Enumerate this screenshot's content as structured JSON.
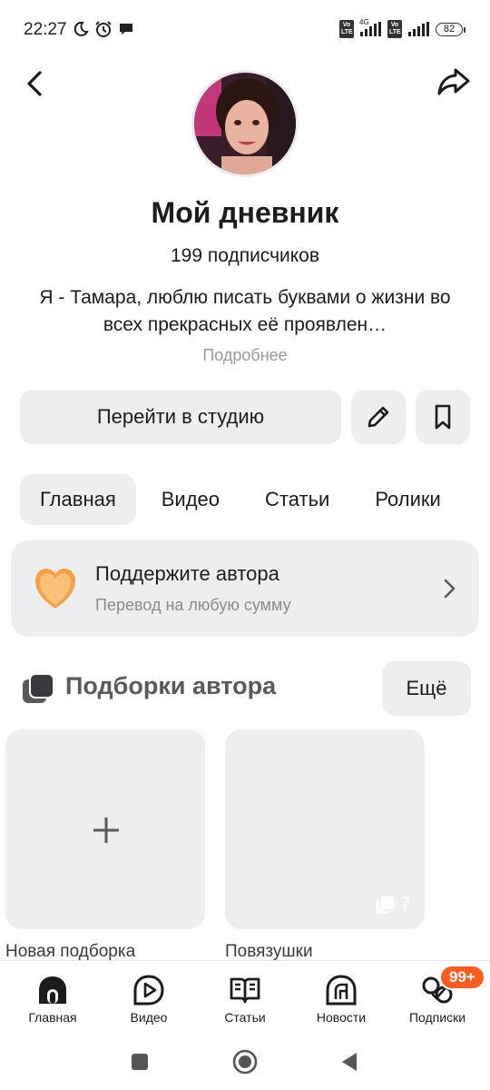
{
  "status_bar": {
    "time": "22:27",
    "battery": "82",
    "net_label": "4G",
    "volte_label": "Vo LTE"
  },
  "header": {
    "back_icon": "chevron-left-icon",
    "share_icon": "share-arrow-icon"
  },
  "profile": {
    "title": "Мой дневник",
    "subscribers": "199 подписчиков",
    "description": "Я - Тамара, люблю писать буквами о жизни во всех прекрасных её проявлен…",
    "more_link": "Подробнее"
  },
  "actions": {
    "studio_label": "Перейти в студию",
    "edit_icon": "pencil-icon",
    "bookmark_icon": "bookmark-icon"
  },
  "tabs": [
    {
      "label": "Главная",
      "active": true
    },
    {
      "label": "Видео",
      "active": false
    },
    {
      "label": "Статьи",
      "active": false
    },
    {
      "label": "Ролики",
      "active": false
    }
  ],
  "support": {
    "title": "Поддержите автора",
    "subtitle": "Перевод на любую сумму",
    "icon": "heart-icon"
  },
  "collections": {
    "title": "Подборки автора",
    "more_label": "Ещё",
    "cards": [
      {
        "label": "Новая подборка",
        "icon": "plus-icon"
      },
      {
        "label": "Повязушки",
        "count": "7"
      }
    ]
  },
  "bottom_nav": [
    {
      "label": "Главная",
      "icon": "home-icon"
    },
    {
      "label": "Видео",
      "icon": "video-icon"
    },
    {
      "label": "Статьи",
      "icon": "articles-icon"
    },
    {
      "label": "Новости",
      "icon": "news-icon"
    },
    {
      "label": "Подписки",
      "icon": "subscriptions-icon"
    }
  ],
  "badge": "99+",
  "colors": {
    "accent_badge": "#ff5a1f",
    "surface": "#eeeef0",
    "text": "#1c1c1e",
    "heart": "#f5a043"
  }
}
